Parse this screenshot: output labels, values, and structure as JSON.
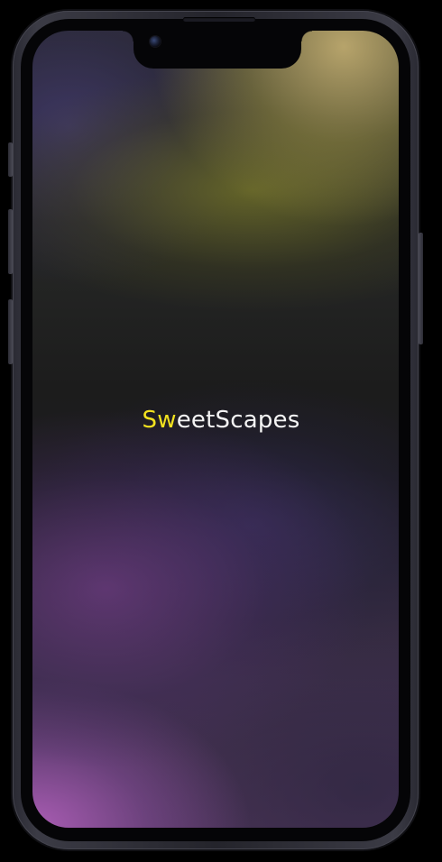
{
  "app": {
    "logo_accent": "Sw",
    "logo_rest": "eetScapes"
  },
  "colors": {
    "logo_accent": "#f2e21f",
    "logo_rest": "#f4f4f4",
    "frame": "#2a2a33",
    "background": "#000000"
  },
  "icons": {
    "camera": "front-camera-icon",
    "speaker": "speaker-grille-icon"
  }
}
